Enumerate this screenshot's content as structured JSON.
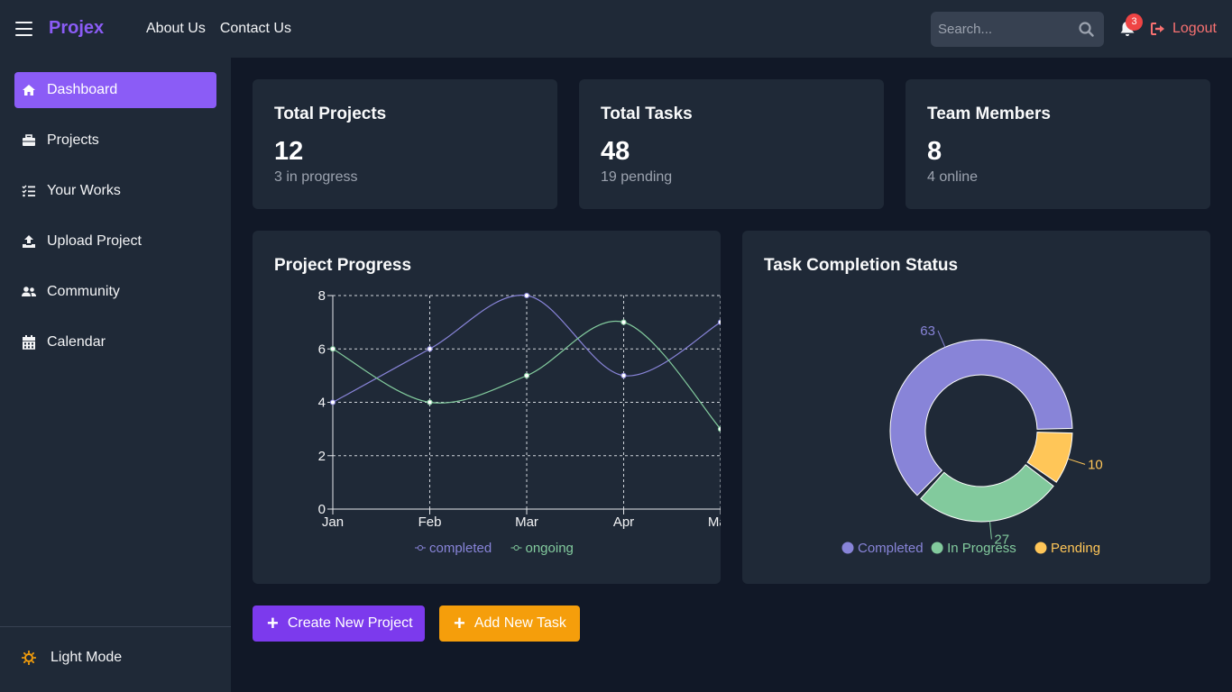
{
  "header": {
    "brand": "Projex",
    "nav": [
      "About Us",
      "Contact Us"
    ],
    "search_placeholder": "Search...",
    "notification_count": "3",
    "logout_label": "Logout"
  },
  "sidebar": {
    "items": [
      {
        "label": "Dashboard",
        "icon": "home-icon",
        "active": true
      },
      {
        "label": "Projects",
        "icon": "briefcase-icon"
      },
      {
        "label": "Your Works",
        "icon": "checklist-icon"
      },
      {
        "label": "Upload Project",
        "icon": "upload-icon"
      },
      {
        "label": "Community",
        "icon": "users-icon"
      },
      {
        "label": "Calendar",
        "icon": "calendar-icon"
      }
    ],
    "theme_toggle_label": "Light Mode"
  },
  "stats": [
    {
      "title": "Total Projects",
      "value": "12",
      "sub": "3 in progress"
    },
    {
      "title": "Total Tasks",
      "value": "48",
      "sub": "19 pending"
    },
    {
      "title": "Team Members",
      "value": "8",
      "sub": "4 online"
    }
  ],
  "panels": {
    "progress_title": "Project Progress",
    "status_title": "Task Completion Status"
  },
  "buttons": {
    "create_project": "Create New Project",
    "add_task": "Add New Task"
  },
  "colors": {
    "accent": "#8b5cf6",
    "completed": "#8884d8",
    "ongoing": "#82ca9d",
    "pending": "#ffc658",
    "danger": "#ef4444",
    "amber": "#f59e0b"
  },
  "chart_data": [
    {
      "type": "line",
      "categories": [
        "Jan",
        "Feb",
        "Mar",
        "Apr",
        "May"
      ],
      "series": [
        {
          "name": "completed",
          "values": [
            4,
            6,
            8,
            5,
            7
          ],
          "color": "#8884d8"
        },
        {
          "name": "ongoing",
          "values": [
            6,
            4,
            5,
            7,
            3
          ],
          "color": "#82ca9d"
        }
      ],
      "yticks": [
        0,
        2,
        4,
        6,
        8
      ],
      "ylim": [
        0,
        8
      ],
      "grid": true,
      "legend": "bottom"
    },
    {
      "type": "pie",
      "donut": true,
      "slices": [
        {
          "label": "Completed",
          "value": 63,
          "color": "#8884d8"
        },
        {
          "label": "In Progress",
          "value": 27,
          "color": "#82ca9d"
        },
        {
          "label": "Pending",
          "value": 10,
          "color": "#ffc658"
        }
      ],
      "legend": "bottom"
    }
  ]
}
